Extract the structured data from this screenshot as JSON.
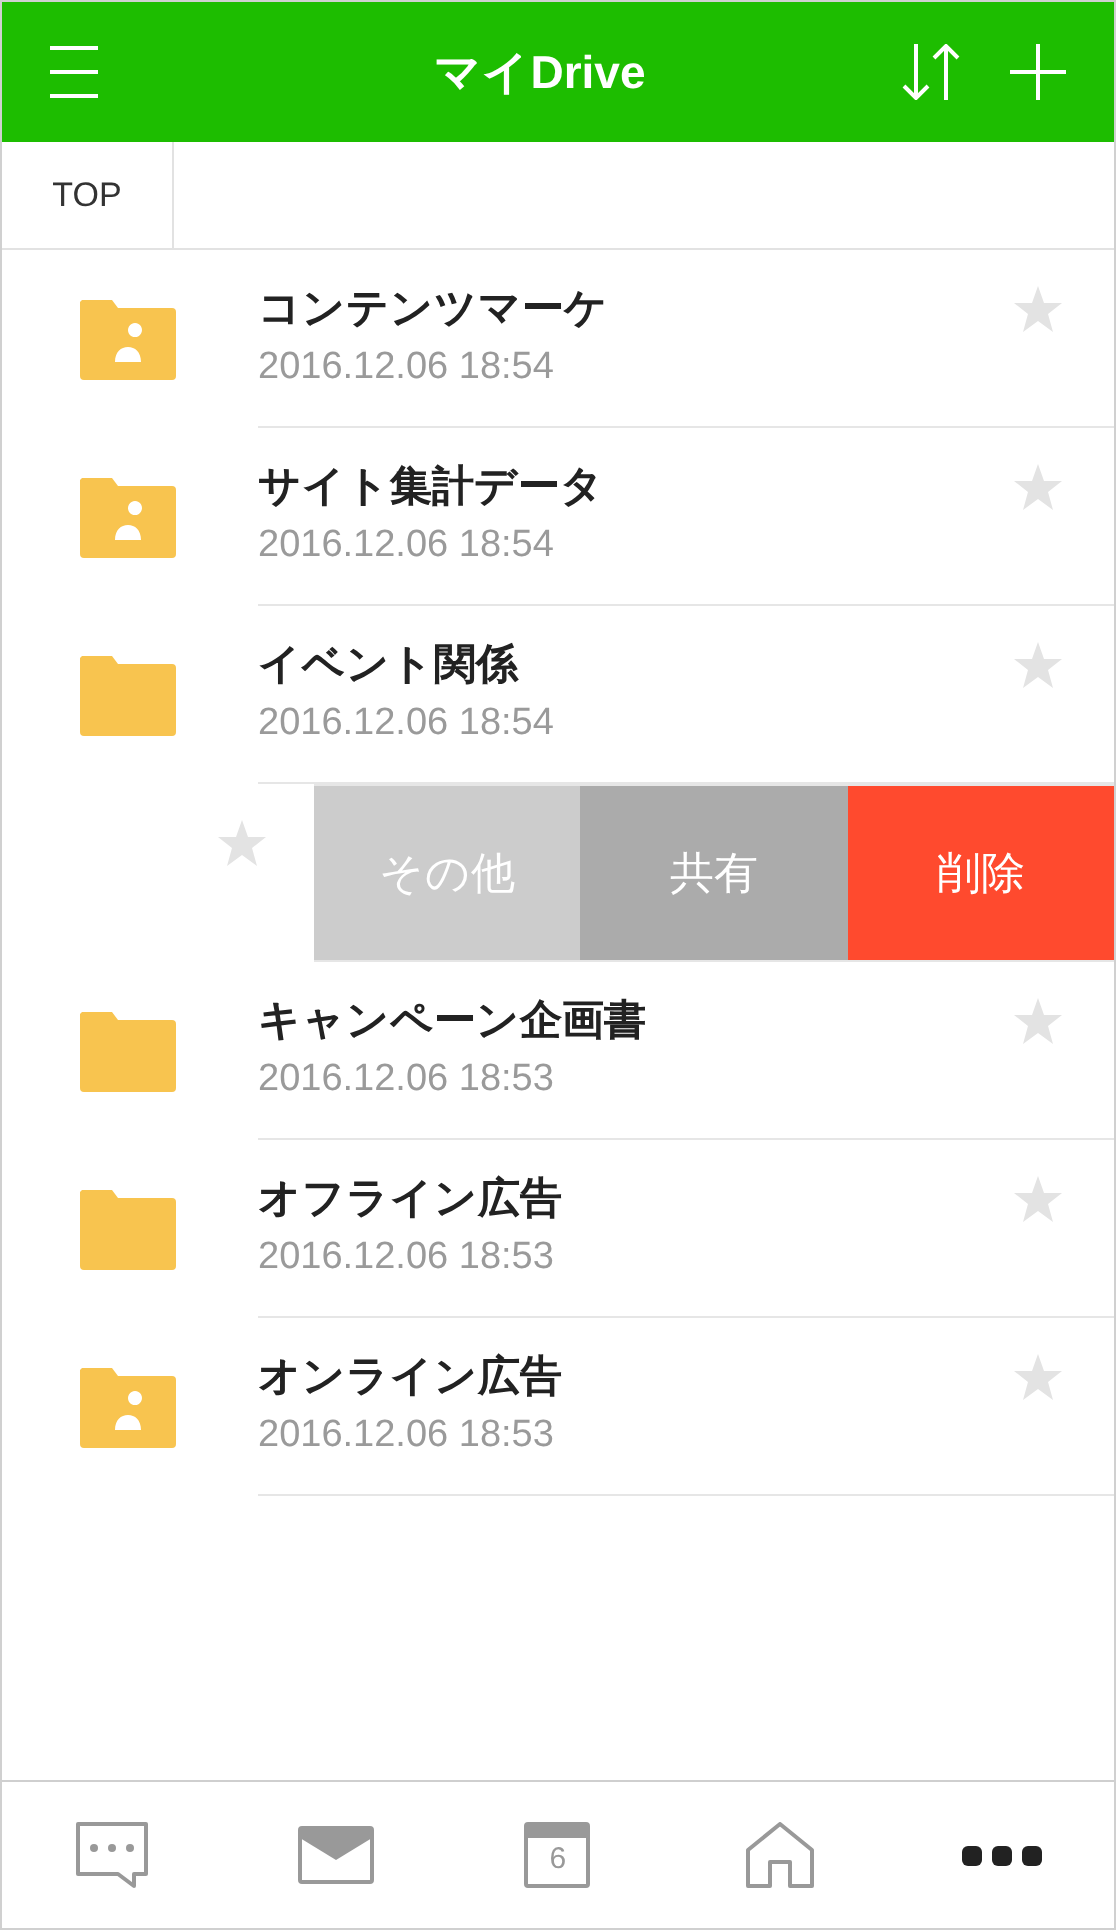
{
  "header": {
    "title": "マイDrive"
  },
  "breadcrumb": [
    "TOP"
  ],
  "items": [
    {
      "kind": "shared",
      "name": "コンテンツマーケ",
      "date": "2016.12.06 18:54",
      "starred": false
    },
    {
      "kind": "shared",
      "name": "サイト集計データ",
      "date": "2016.12.06 18:54",
      "starred": false
    },
    {
      "kind": "folder",
      "name": "イベント関係",
      "date": "2016.12.06 18:54",
      "starred": false
    },
    {
      "kind": "swiped",
      "starred": false,
      "actions": [
        {
          "kind": "more",
          "label": "その他"
        },
        {
          "kind": "share",
          "label": "共有"
        },
        {
          "kind": "delete",
          "label": "削除"
        }
      ]
    },
    {
      "kind": "folder",
      "name": "キャンペーン企画書",
      "date": "2016.12.06 18:53",
      "starred": false
    },
    {
      "kind": "folder",
      "name": "オフライン広告",
      "date": "2016.12.06 18:53",
      "starred": false
    },
    {
      "kind": "shared",
      "name": "オンライン広告",
      "date": "2016.12.06 18:53",
      "starred": false
    }
  ],
  "tab_bar": [
    {
      "kind": "chat",
      "selected": false
    },
    {
      "kind": "mail",
      "selected": false
    },
    {
      "kind": "calendar",
      "label": "6",
      "selected": false
    },
    {
      "kind": "home",
      "selected": false
    },
    {
      "kind": "more",
      "selected": true
    }
  ]
}
